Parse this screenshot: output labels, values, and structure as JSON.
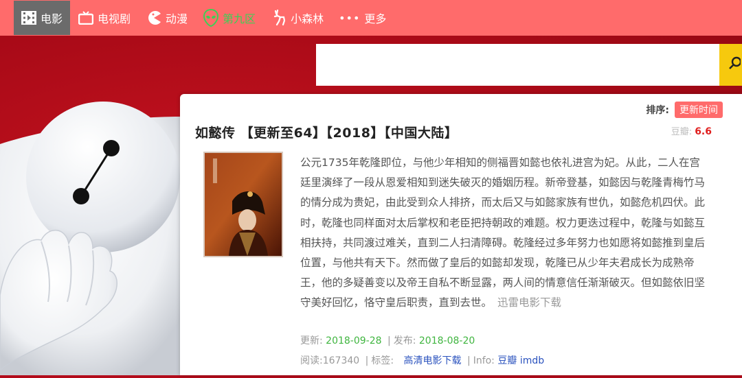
{
  "nav": {
    "items": [
      {
        "label": "电影",
        "icon": "film-icon"
      },
      {
        "label": "电视剧",
        "icon": "tv-icon"
      },
      {
        "label": "动漫",
        "icon": "pacman-icon"
      },
      {
        "label": "第九区",
        "icon": "alien-icon"
      },
      {
        "label": "小森林",
        "icon": "deer-icon"
      },
      {
        "label": "更多",
        "icon": "more-dots-icon"
      }
    ]
  },
  "search": {
    "placeholder": "",
    "value": "",
    "button_icon": "search-icon"
  },
  "sort": {
    "label": "排序:",
    "button": "更新时间"
  },
  "movie": {
    "title": "如懿传 【更新至64】【2018】【中国大陆】",
    "rating_label": "豆瓣:",
    "rating_value": "6.6",
    "description": "公元1735年乾隆即位，与他少年相知的侧福晋如懿也依礼进宫为妃。从此，二人在宫廷里演绎了一段从恩爱相知到迷失破灭的婚姻历程。新帝登基，如懿因与乾隆青梅竹马的情分成为贵妃，由此受到众人排挤，而太后又与如懿家族有世仇，如懿危机四伏。此时，乾隆也同样面对太后掌权和老臣把持朝政的难题。权力更迭过程中，乾隆与如懿互相扶持，共同渡过难关，直到二人扫清障碍。乾隆经过多年努力也如愿将如懿推到皇后位置，与他共有天下。然而做了皇后的如懿却发现，乾隆已从少年夫君成长为成熟帝王，他的多疑善变以及帝王自私不断显露，两人间的情意信任渐渐破灭。但如懿依旧坚守美好回忆，恪守皇后职责，直到去世。",
    "download_link": "迅雷电影下载",
    "updated_label": "更新:",
    "updated_date": "2018-09-28",
    "released_label": "发布:",
    "released_date": "2018-08-20",
    "reads_label": "阅读:",
    "reads_count": "167340",
    "tags_label": "标签:",
    "tag": "高清电影下载",
    "info_label": "Info:",
    "info_link1": "豆瓣",
    "info_link2": "imdb"
  },
  "colors": {
    "nav_bg": "#ff6b6b",
    "active_nav_bg": "#6b6b6b",
    "page_bg": "#b30c1b",
    "accent_green": "#3fb53f",
    "rating_red": "#e0201f",
    "search_button": "#f6c90e"
  }
}
